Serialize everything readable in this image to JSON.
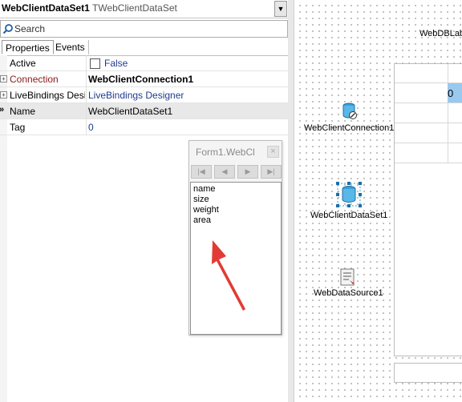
{
  "combo": {
    "name": "WebClientDataSet1",
    "type": "TWebClientDataSet"
  },
  "search": {
    "placeholder": "Search"
  },
  "tabs": [
    {
      "label": "Properties"
    },
    {
      "label": "Events"
    }
  ],
  "properties": [
    {
      "name": "Active",
      "value": "False",
      "name_color": "#000000",
      "value_color": "#1f3a93"
    },
    {
      "name": "Connection",
      "value": "WebClientConnection1",
      "name_color": "#8b1a1a",
      "value_color": "#000000"
    },
    {
      "name": "LiveBindings Designer",
      "value": "LiveBindings Designer",
      "name_color": "#000000",
      "value_color": "#1f3a93"
    },
    {
      "name": "Name",
      "value": "WebClientDataSet1",
      "name_color": "#000000",
      "value_color": "#000000"
    },
    {
      "name": "Tag",
      "value": "0",
      "name_color": "#000000",
      "value_color": "#1f3a93"
    }
  ],
  "designer": {
    "top_label": "WebDBLabel",
    "grid_cell": "0",
    "components": [
      {
        "label": "WebClientConnection1",
        "icon": "database-connection-icon"
      },
      {
        "label": "WebClientDataSet1",
        "icon": "dataset-icon"
      },
      {
        "label": "WebDataSource1",
        "icon": "datasource-icon"
      }
    ]
  },
  "window": {
    "title": "Form1.WebCl",
    "close": "×",
    "nav": [
      "|◀",
      "◀",
      "▶",
      "▶|"
    ],
    "fields": [
      "name",
      "size",
      "weight",
      "area"
    ]
  },
  "colors": {
    "accent_arrow": "#e23b36",
    "selection": "#99c9ef"
  }
}
